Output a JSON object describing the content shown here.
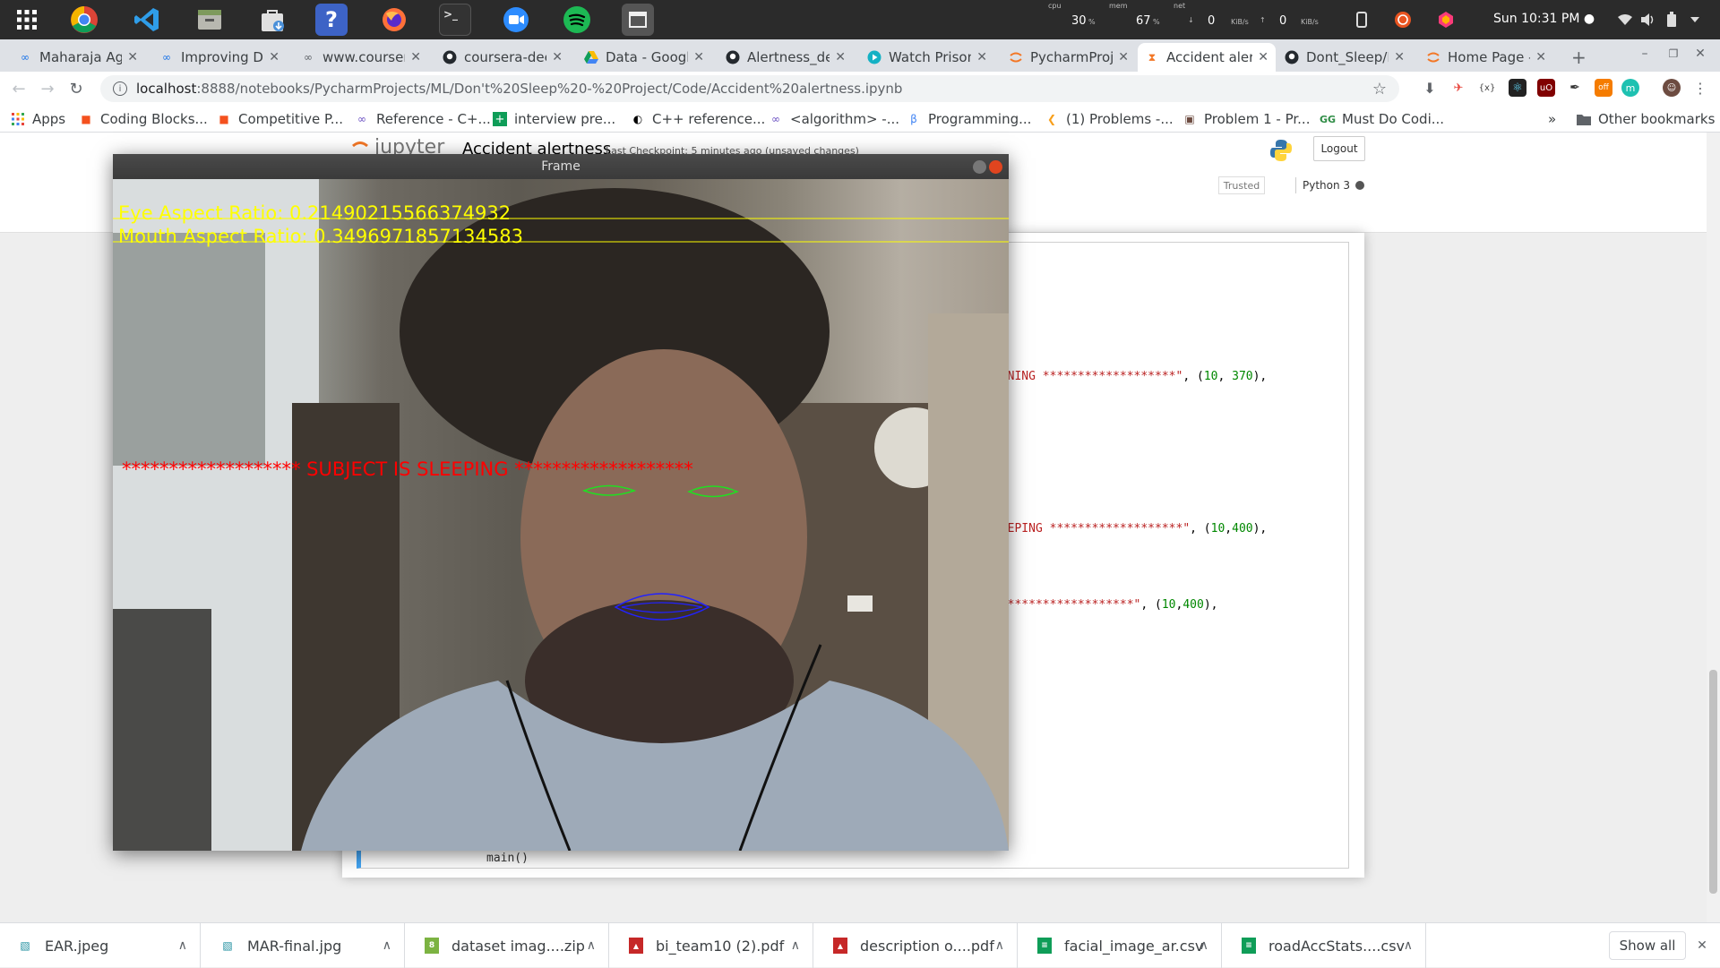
{
  "system_panel": {
    "cpu_label": "cpu",
    "cpu_value": "30",
    "mem_label": "mem",
    "mem_value": "67",
    "net_label": "net",
    "net_down": "0",
    "net_up": "0",
    "unit": "KiB/s",
    "percent": "%",
    "clock": "Sun 10:31 PM ●"
  },
  "tabs": [
    {
      "title": "Maharaja Agr",
      "favicon": "∞",
      "active": false
    },
    {
      "title": "Improving De",
      "favicon": "∞",
      "active": false
    },
    {
      "title": "www.courser",
      "favicon": "∞",
      "active": false
    },
    {
      "title": "coursera-dee",
      "favicon": "github",
      "active": false
    },
    {
      "title": "Data - Google",
      "favicon": "drive",
      "active": false
    },
    {
      "title": "Alertness_de",
      "favicon": "github",
      "active": false
    },
    {
      "title": "Watch Prison",
      "favicon": "play",
      "active": false
    },
    {
      "title": "PycharmProj",
      "favicon": "jupyter",
      "active": false
    },
    {
      "title": "Accident aler",
      "favicon": "jupyter-hourglass",
      "active": true
    },
    {
      "title": "Dont_Sleep/F",
      "favicon": "github",
      "active": false
    },
    {
      "title": "Home Page - ",
      "favicon": "jupyter",
      "active": false
    }
  ],
  "new_tab": "+",
  "url": {
    "host": "localhost",
    "path": ":8888/notebooks/PycharmProjects/ML/Don't%20Sleep%20-%20Project/Code/Accident%20alertness.ipynb"
  },
  "bookmarks": [
    {
      "label": "Apps"
    },
    {
      "label": "Coding Blocks..."
    },
    {
      "label": "Competitive P..."
    },
    {
      "label": "Reference - C+..."
    },
    {
      "label": "interview pre..."
    },
    {
      "label": "C++ reference..."
    },
    {
      "label": "<algorithm> -..."
    },
    {
      "label": "Programming..."
    },
    {
      "label": "(1) Problems -..."
    },
    {
      "label": "Problem 1 - Pr..."
    },
    {
      "label": "Must Do Codi..."
    }
  ],
  "bookmarks_more": "»",
  "other_bookmarks": "Other bookmarks",
  "jupyter": {
    "logo": "jupyter",
    "notebook_name": "Accident alertness",
    "checkpoint": "Last Checkpoint: 5 minutes ago  (unsaved changes)",
    "logout": "Logout",
    "trusted": "Trusted",
    "kernel": "Python 3"
  },
  "code_fragments": {
    "line1_str": "AWNING *******************\"",
    "line1_rest": ", (",
    "line1_n1": "10",
    "line1_sep": ", ",
    "line1_n2": "370",
    "line1_end": "),",
    "line2_str": "LEEPING *******************\"",
    "line2_rest": ", (",
    "line2_n1": "10",
    "line2_sep": ",",
    "line2_n2": "400",
    "line2_end": "),",
    "line3_str": " *******************\"",
    "line3_rest": ", (",
    "line3_n1": "10",
    "line3_sep": ",",
    "line3_n2": "400",
    "line3_end": "),",
    "main_call": "main()"
  },
  "frame_window": {
    "title": "Frame",
    "ear_text": "Eye Aspect Ratio: 0.21490215566374932",
    "mar_text": "Mouth Aspect Ratio: 0.3496971857134583",
    "alert_text": "******************* SUBJECT IS SLEEPING *******************",
    "overlay_yellow": "#ffff00",
    "overlay_red": "#ff0000"
  },
  "downloads": [
    {
      "name": "EAR.jpeg",
      "icon": "image"
    },
    {
      "name": "MAR-final.jpg",
      "icon": "image"
    },
    {
      "name": "dataset imag....zip",
      "icon": "archive"
    },
    {
      "name": "bi_team10 (2).pdf",
      "icon": "pdf"
    },
    {
      "name": "description o....pdf",
      "icon": "pdf"
    },
    {
      "name": "facial_image_ar.csv",
      "icon": "sheet"
    },
    {
      "name": "roadAccStats....csv",
      "icon": "sheet"
    }
  ],
  "show_all": "Show all"
}
